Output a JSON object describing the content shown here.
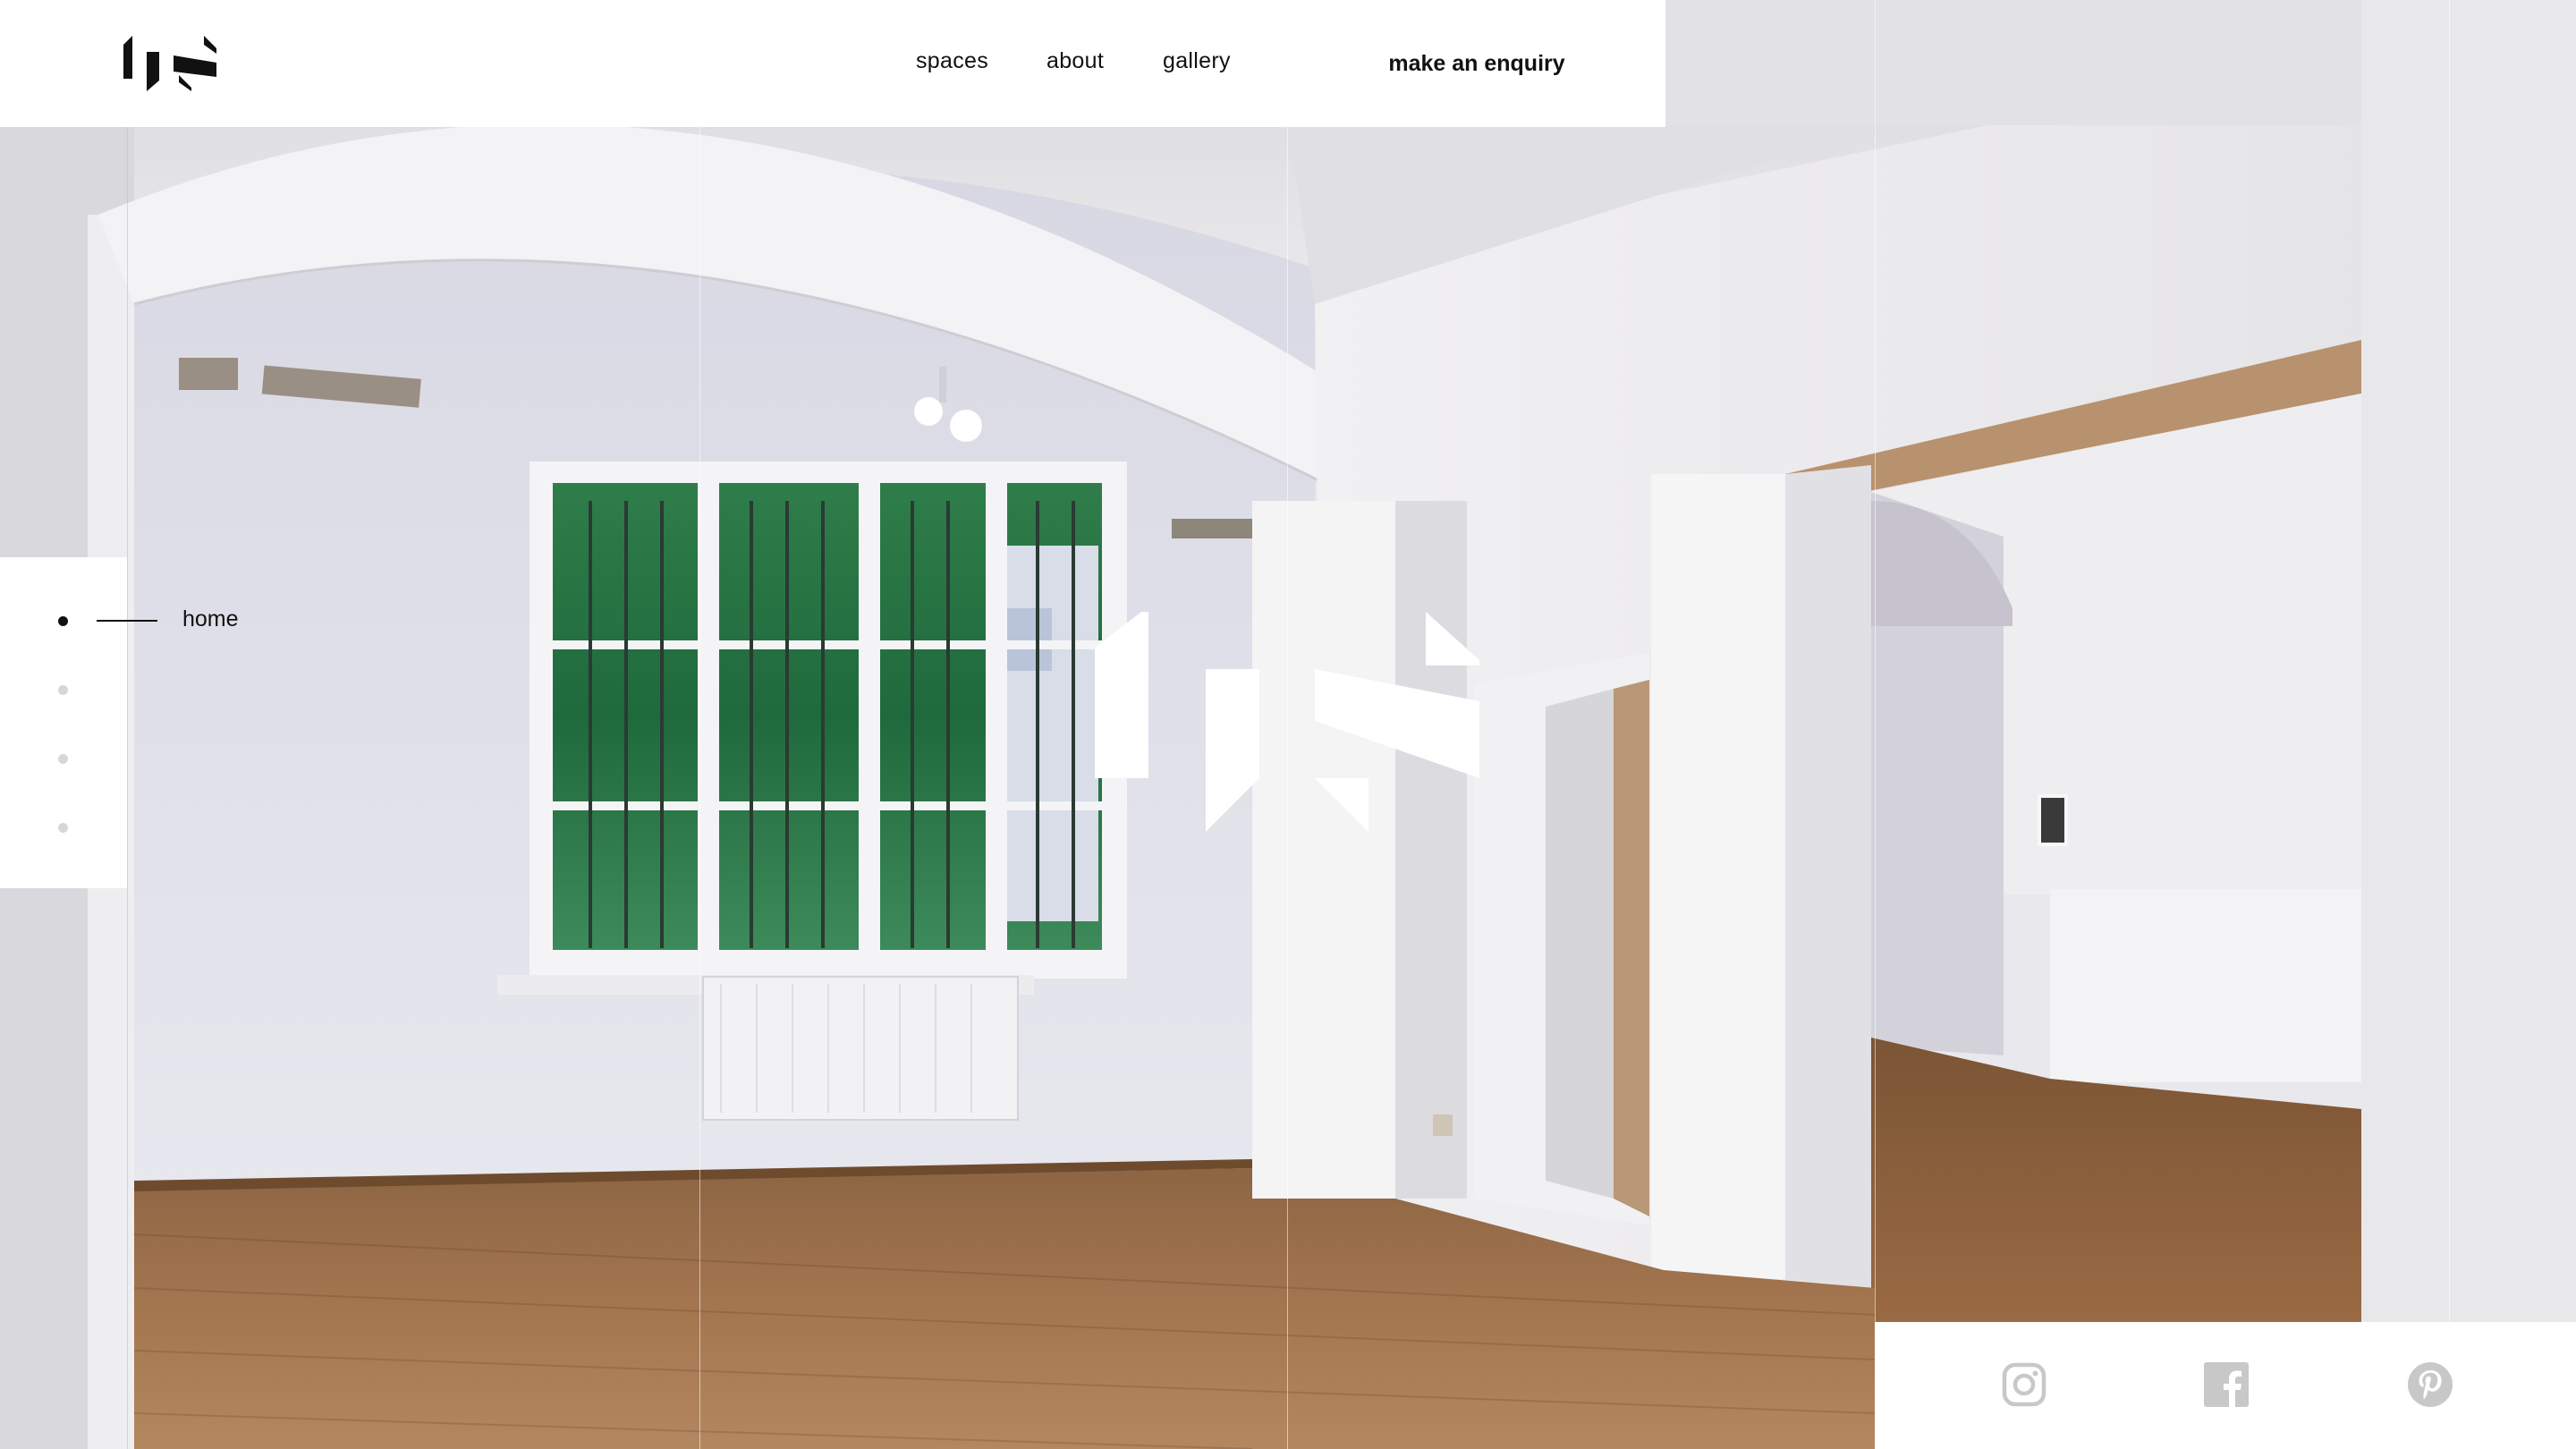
{
  "header": {
    "logo_icon": "brand-logo-icon",
    "nav": [
      {
        "label": "spaces"
      },
      {
        "label": "about"
      },
      {
        "label": "gallery"
      }
    ],
    "cta_label": "make an enquiry"
  },
  "hero": {
    "logo_icon": "brand-logo-mark",
    "background": "empty white gallery room with arched doorway, tall barred window and wooden floor"
  },
  "slides": {
    "active_label": "home",
    "count": 4,
    "active_index": 0
  },
  "social": [
    {
      "icon": "instagram-icon"
    },
    {
      "icon": "facebook-icon"
    },
    {
      "icon": "pinterest-icon"
    }
  ],
  "colors": {
    "text": "#111111",
    "panel": "#ffffff",
    "inactive_dot": "#d7d7d7",
    "social_icon": "#c8c8c8",
    "floor": "#9a6a3e"
  }
}
